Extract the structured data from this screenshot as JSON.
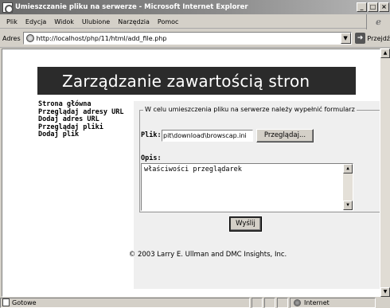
{
  "window": {
    "title": "Umieszczanie pliku na serwerze - Microsoft Internet Explorer",
    "buttons": [
      "_",
      "□",
      "×"
    ]
  },
  "menu": {
    "items": [
      {
        "label": "Plik"
      },
      {
        "label": "Edycja"
      },
      {
        "label": "Widok"
      },
      {
        "label": "Ulubione"
      },
      {
        "label": "Narzędzia"
      },
      {
        "label": "Pomoc"
      }
    ]
  },
  "address": {
    "label": "Adres",
    "url": "http://localhost/php/11/html/add_file.php",
    "go_label": "Przejdź"
  },
  "page": {
    "banner_title": "Zarządzanie zawartością stron",
    "nav": [
      {
        "label": "Strona główna"
      },
      {
        "label": "Przeglądaj adresy URL"
      },
      {
        "label": "Dodaj adres URL"
      },
      {
        "label": "Przeglądaj pliki"
      },
      {
        "label": "Dodaj plik"
      }
    ],
    "form": {
      "legend": "W celu umieszczenia pliku na serwerze należy wypełnić formularz",
      "file_label": "Plik:",
      "file_value": "pit\\download\\browscap.ini",
      "browse_label": "Przeglądaj...",
      "desc_label": "Opis:",
      "desc_value": "właściwości przeglądarek",
      "submit_label": "Wyślij"
    },
    "footer": "© 2003 Larry E. Ullman and DMC Insights, Inc."
  },
  "status": {
    "text": "Gotowe",
    "zone": "Internet"
  }
}
